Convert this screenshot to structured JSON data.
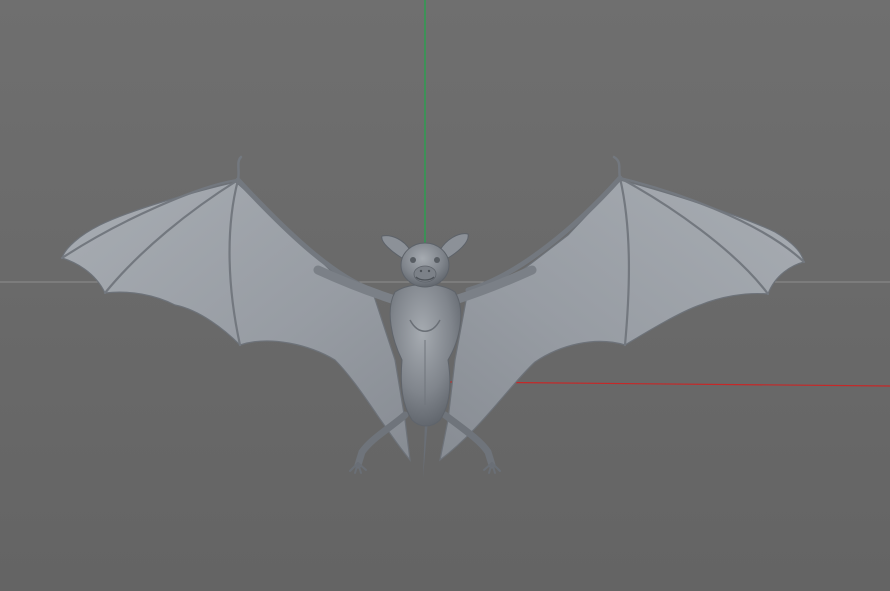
{
  "viewport": {
    "background_top": "#6f6f6f",
    "background_bottom": "#646464",
    "horizon_line_color": "#8f8f8f",
    "y_axis_color": "#1fa84a",
    "x_axis_color": "#c62828"
  },
  "model": {
    "name_icon": "bat-model",
    "surface_color": "#8d9299",
    "membrane_color": "#9ba0a7",
    "shadow_color": "#5f646b",
    "highlight_color": "#b3b8be",
    "bone_color": "#7c8189"
  }
}
